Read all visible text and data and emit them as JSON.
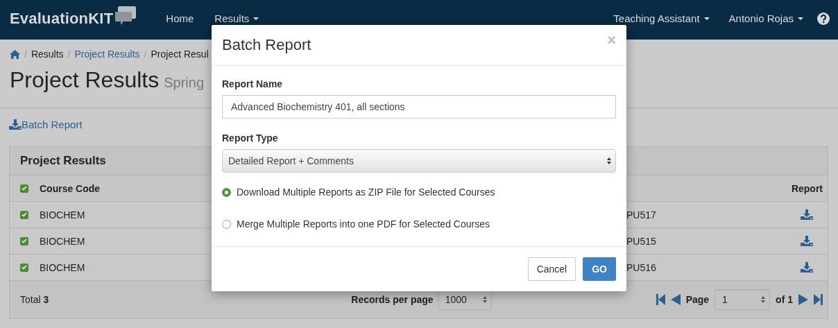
{
  "navbar": {
    "brand": "EvaluationKIT",
    "menu": [
      {
        "label": "Home",
        "dropdown": false
      },
      {
        "label": "Results",
        "dropdown": true
      }
    ],
    "right_menu": [
      {
        "label": "Teaching Assistant",
        "dropdown": true
      },
      {
        "label": "Antonio Rojas",
        "dropdown": true
      }
    ]
  },
  "breadcrumb": [
    {
      "separator": "/",
      "label": "Results",
      "link": false
    },
    {
      "separator": "/",
      "label": "Project Results",
      "link": true
    },
    {
      "separator": "/",
      "label": "Project Resul",
      "link": false
    }
  ],
  "page_title": "Project Results",
  "page_subtitle": "Spring",
  "batch_link": "Batch Report",
  "panel": {
    "title": "Project Results",
    "select_all": {
      "checked": true
    },
    "columns": [
      "Course Code",
      "Report"
    ],
    "rows": [
      {
        "checked": true,
        "course_code": "BIOCHEM",
        "column_3": "PU517"
      },
      {
        "checked": true,
        "course_code": "BIOCHEM",
        "column_3": "PU515"
      },
      {
        "checked": true,
        "course_code": "BIOCHEM",
        "column_3": "PU516"
      }
    ],
    "footer": {
      "total_label": "Total",
      "total": "3",
      "records_label": "Records per page",
      "records_value": "1000",
      "page_label": "Page",
      "page_value": "1",
      "page_of": "of 1"
    }
  },
  "modal": {
    "title": "Batch Report",
    "close": "×",
    "report_name_label": "Report Name",
    "report_name_value": "Advanced Biochemistry 401, all sections",
    "report_type_label": "Report Type",
    "report_type_value": "Detailed Report + Comments",
    "options": [
      {
        "label": "Download Multiple Reports as ZIP File for Selected Courses",
        "selected": true
      },
      {
        "label": "Merge Multiple Reports into one PDF for Selected Courses",
        "selected": false
      }
    ],
    "buttons": [
      {
        "label": "Cancel",
        "kind": "default"
      },
      {
        "label": "GO",
        "kind": "primary"
      }
    ]
  }
}
